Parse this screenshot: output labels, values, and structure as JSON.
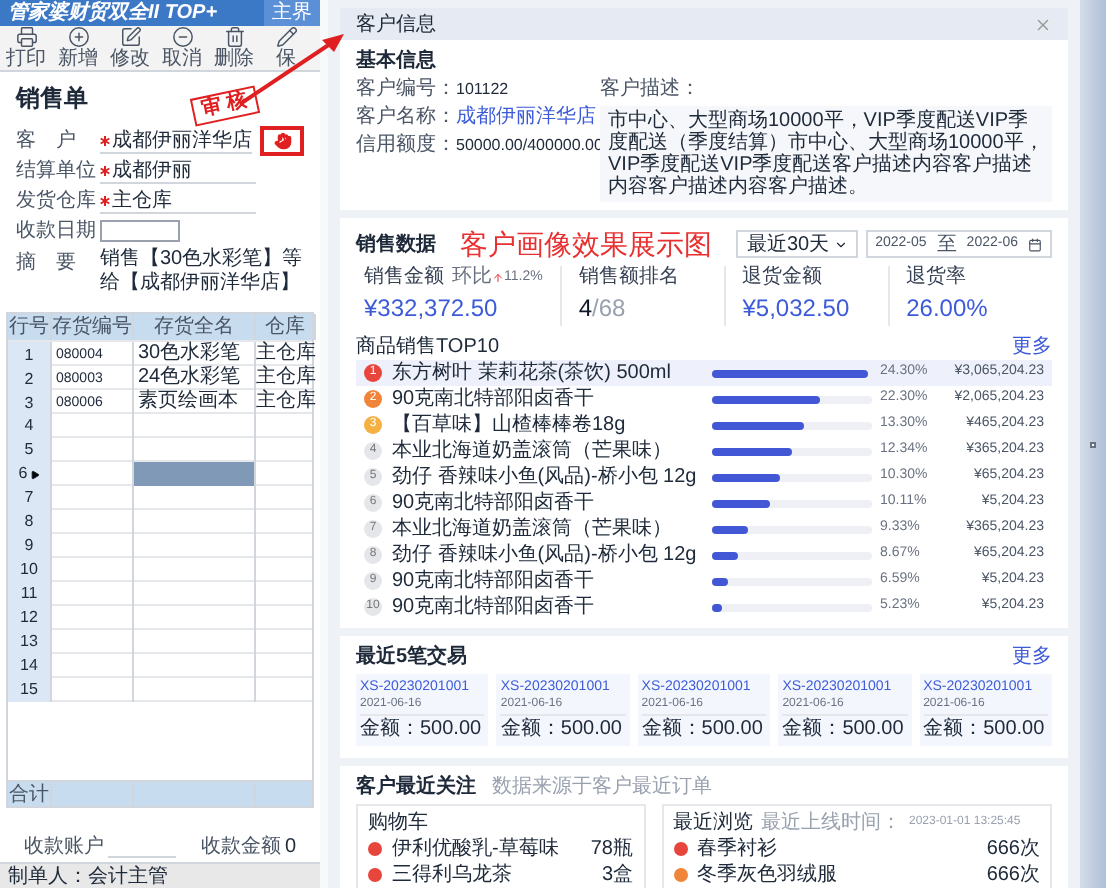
{
  "app_window": {
    "title": "管家婆财贸双全II TOP+",
    "home_button": "主界",
    "toolbar": [
      "打印",
      "新增",
      "修改",
      "取消",
      "删除",
      "保"
    ],
    "form_title": "销售单",
    "stamp": "审 核",
    "fields": [
      {
        "label": "客　户",
        "value": "成都伊丽洋华店",
        "required": true,
        "kind": "customer"
      },
      {
        "label": "结算单位",
        "value": "成都伊丽",
        "required": true,
        "kind": "text"
      },
      {
        "label": "发货仓库",
        "value": "主仓库",
        "required": true,
        "kind": "text"
      },
      {
        "label": "收款日期",
        "required": false,
        "kind": "date"
      }
    ],
    "summary_label": "摘　要",
    "summary": "销售【30色水彩笔】等给【成都伊丽洋华店】",
    "columns": [
      "行号",
      "存货编号",
      "存货全名",
      "仓库"
    ],
    "rows": [
      {
        "cells": [
          "1",
          "080004",
          "30色水彩笔",
          "主仓库"
        ],
        "selected": false
      },
      {
        "cells": [
          "2",
          "080003",
          "24色水彩笔",
          "主仓库"
        ],
        "selected": false
      },
      {
        "cells": [
          "3",
          "080006",
          "素页绘画本",
          "主仓库"
        ],
        "selected": false
      },
      {
        "cells": [
          "4"
        ],
        "selected": false
      },
      {
        "cells": [
          "5"
        ],
        "selected": false
      },
      {
        "cells": [
          "6"
        ],
        "selected": true
      },
      {
        "cells": [
          "7"
        ],
        "selected": false
      },
      {
        "cells": [
          "8"
        ],
        "selected": false
      },
      {
        "cells": [
          "9"
        ],
        "selected": false
      },
      {
        "cells": [
          "10"
        ],
        "selected": false
      },
      {
        "cells": [
          "11"
        ],
        "selected": false
      },
      {
        "cells": [
          "12"
        ],
        "selected": false
      },
      {
        "cells": [
          "13"
        ],
        "selected": false
      },
      {
        "cells": [
          "14"
        ],
        "selected": false
      },
      {
        "cells": [
          "15"
        ],
        "selected": false
      }
    ],
    "total_label": "合计",
    "account_label": "收款账户",
    "amount_label": "收款金额",
    "amount": "0",
    "status": "制单人：会计主管"
  },
  "customer_panel": {
    "title": "客户信息",
    "basic": {
      "title": "基本信息",
      "fields": [
        {
          "label": "客户编号：",
          "value": "101122",
          "kind": "text"
        },
        {
          "label": "客户名称：",
          "value": "成都伊丽洋华店",
          "kind": "link"
        },
        {
          "label": "信用额度：",
          "value": "50000.00/400000.00",
          "kind": "text"
        }
      ],
      "description_label": "客户描述：",
      "description": "市中心、大型商场10000平，VIP季度配送VIP季度配送（季度结算）市中心、大型商场10000平，VIP季度配送VIP季度配送客户描述内容客户描述内容客户描述内容客户描述。"
    },
    "annotation": "客户画像效果展示图",
    "sales": {
      "title": "销售数据",
      "range": "最近30天",
      "date_from": "2022-05",
      "date_sep": "至",
      "date_to": "2022-06",
      "stats": [
        {
          "label": "销售金额",
          "trend_label": "环比",
          "trend": "11.2%",
          "value": "¥332,372.50",
          "kind": "money"
        },
        {
          "label": "销售额排名",
          "value": "4",
          "total": "/68",
          "kind": "rank"
        },
        {
          "label": "退货金额",
          "value": "¥5,032.50",
          "kind": "money"
        },
        {
          "label": "退货率",
          "value": "26.00%",
          "kind": "money"
        }
      ]
    },
    "top10": {
      "title": "商品销售TOP10",
      "more": "更多",
      "items": [
        {
          "rank": "1",
          "color": "#e8453c",
          "name": "东方树叶 茉莉花茶(茶饮) 500ml",
          "level": 0.97,
          "percent": "24.30%",
          "amount": "¥3,065,204.23",
          "selected": true
        },
        {
          "rank": "2",
          "color": "#f0853a",
          "name": "90克南北特部阳卤香干",
          "level": 0.68,
          "percent": "22.30%",
          "amount": "¥2,065,204.23",
          "selected": false
        },
        {
          "rank": "3",
          "color": "#f5b041",
          "name": "【百草味】山楂棒棒卷18g",
          "level": 0.58,
          "percent": "13.30%",
          "amount": "¥465,204.23",
          "selected": false
        },
        {
          "rank": "4",
          "color": "#e4e6ea",
          "name": "本业北海道奶盖滚筒（芒果味）",
          "level": 0.5,
          "percent": "12.34%",
          "amount": "¥365,204.23",
          "selected": false
        },
        {
          "rank": "5",
          "color": "#e4e6ea",
          "name": "劲仔 香辣味小鱼(风品)-桥小包 12g",
          "level": 0.42,
          "percent": "10.30%",
          "amount": "¥65,204.23",
          "selected": false
        },
        {
          "rank": "6",
          "color": "#e4e6ea",
          "name": "90克南北特部阳卤香干",
          "level": 0.36,
          "percent": "10.11%",
          "amount": "¥5,204.23",
          "selected": false
        },
        {
          "rank": "7",
          "color": "#e4e6ea",
          "name": "本业北海道奶盖滚筒（芒果味）",
          "level": 0.22,
          "percent": "9.33%",
          "amount": "¥365,204.23",
          "selected": false
        },
        {
          "rank": "8",
          "color": "#e4e6ea",
          "name": "劲仔 香辣味小鱼(风品)-桥小包 12g",
          "level": 0.16,
          "percent": "8.67%",
          "amount": "¥65,204.23",
          "selected": false
        },
        {
          "rank": "9",
          "color": "#e4e6ea",
          "name": "90克南北特部阳卤香干",
          "level": 0.1,
          "percent": "6.59%",
          "amount": "¥5,204.23",
          "selected": false
        },
        {
          "rank": "10",
          "color": "#e4e6ea",
          "name": "90克南北特部阳卤香干",
          "level": 0.06,
          "percent": "5.23%",
          "amount": "¥5,204.23",
          "selected": false
        }
      ]
    },
    "trades": {
      "title": "最近5笔交易",
      "more": "更多",
      "items": [
        {
          "number": "XS-20230201001",
          "date": "2021-06-16",
          "amount": "金额：500.00"
        },
        {
          "number": "XS-20230201001",
          "date": "2021-06-16",
          "amount": "金额：500.00"
        },
        {
          "number": "XS-20230201001",
          "date": "2021-06-16",
          "amount": "金额：500.00"
        },
        {
          "number": "XS-20230201001",
          "date": "2021-06-16",
          "amount": "金额：500.00"
        },
        {
          "number": "XS-20230201001",
          "date": "2021-06-16",
          "amount": "金额：500.00"
        }
      ]
    },
    "interests": {
      "title": "客户最近关注",
      "subtitle": "数据来源于客户最近订单",
      "cart": {
        "title": "购物车",
        "items": [
          {
            "name": "伊利优酸乳-草莓味",
            "count": "78瓶",
            "color": "#e8453c"
          },
          {
            "name": "三得利乌龙茶",
            "count": "3盒",
            "color": "#e8453c"
          }
        ]
      },
      "browsing": {
        "title": "最近浏览",
        "time_label": "最近上线时间：",
        "time": "2023-01-01 13:25:45",
        "items": [
          {
            "name": "春季衬衫",
            "count": "666次",
            "color": "#e8453c"
          },
          {
            "name": "冬季灰色羽绒服",
            "count": "666次",
            "color": "#f0853a"
          }
        ]
      }
    }
  }
}
